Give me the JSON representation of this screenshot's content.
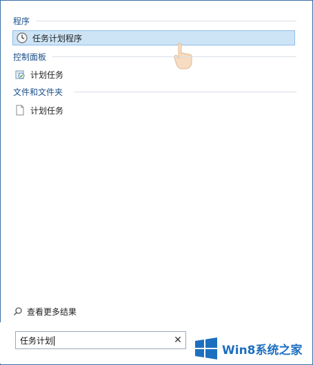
{
  "sections": {
    "programs": {
      "title": "程序",
      "items": [
        {
          "label": "任务计划程序",
          "icon": "clock-icon",
          "selected": true
        }
      ]
    },
    "control_panel": {
      "title": "控制面板",
      "items": [
        {
          "label": "计划任务",
          "icon": "scheduled-task-icon",
          "selected": false
        }
      ]
    },
    "files_folders": {
      "title": "文件和文件夹",
      "items": [
        {
          "label": "计划任务",
          "icon": "document-icon",
          "selected": false
        }
      ]
    }
  },
  "more_results": {
    "label": "查看更多结果",
    "icon": "search-icon"
  },
  "search": {
    "value": "任务计划",
    "clear_icon": "close-icon"
  },
  "watermark": {
    "text": "Win8系统之家",
    "logo": "windows-logo"
  },
  "colors": {
    "section_title": "#1a4f8a",
    "selected_bg": "#cde4f7",
    "selected_border": "#8fbce6",
    "frame": "#3a6ea5",
    "watermark": "#1d6fc0"
  }
}
